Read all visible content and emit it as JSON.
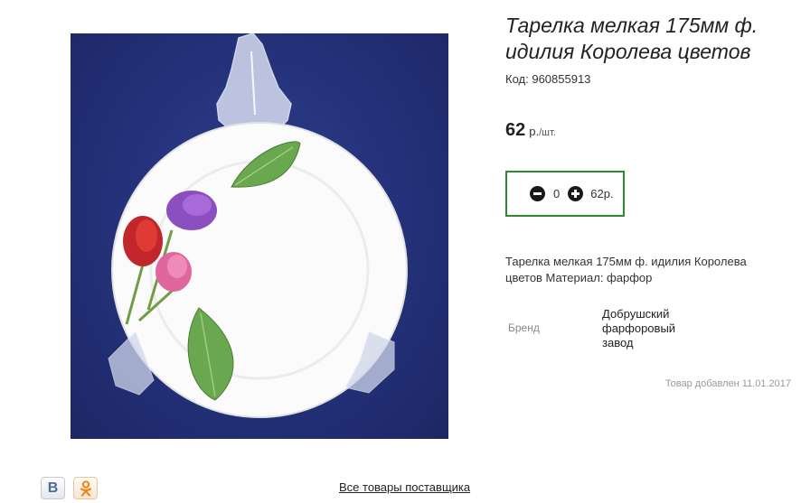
{
  "product": {
    "title": "Тарелка мелкая 175мм ф. идилия Королева цветов",
    "code_label": "Код:",
    "code_value": "960855913",
    "price_value": "62",
    "price_currency": "р.",
    "price_per": "/шт.",
    "description": "Тарелка мелкая 175мм ф. идилия Королева цветов Материал: фарфор",
    "brand_label": "Бренд",
    "brand_value": "Добрушский фарфоровый завод",
    "added_text": "Товар добавлен 11.01.2017"
  },
  "cart": {
    "quantity": "0",
    "total": "62р."
  },
  "footer": {
    "supplier_link": "Все товары поставщика",
    "vk_letter": "В"
  },
  "colors": {
    "accent_border": "#2e8b2e",
    "image_background": "#243178"
  },
  "icons": {
    "minus": "minus-circle-icon",
    "plus": "plus-circle-icon",
    "vk": "vkontakte-icon",
    "ok": "odnoklassniki-icon"
  }
}
